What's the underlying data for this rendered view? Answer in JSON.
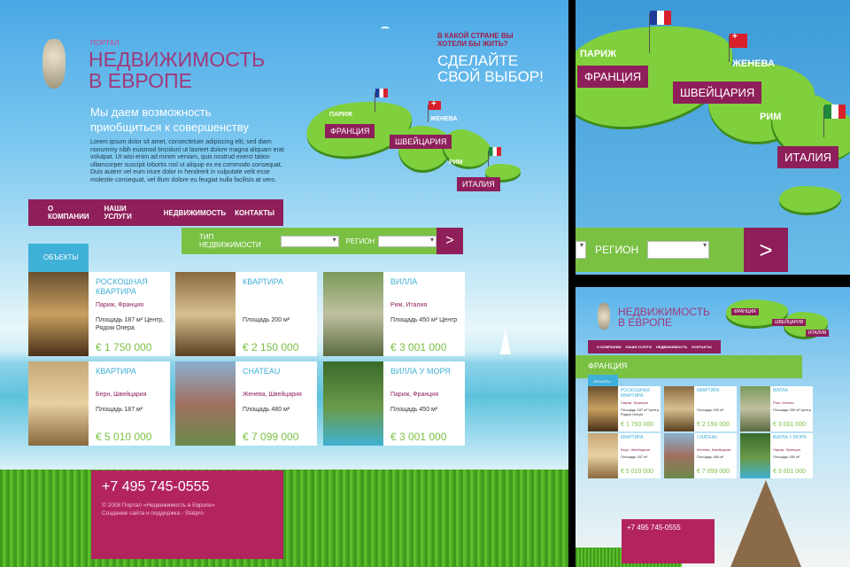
{
  "header": {
    "portal_label": "ПОРТАЛ",
    "title_line1": "НЕДВИЖИМОСТЬ",
    "title_line2": "В ЕВРОПЕ",
    "tagline": "Мы даем возможность приобщиться к совершенству",
    "body": "Lorem ipsum dolor sit amet, consectetuer adipiscing elit, sed diam nonummy nibh euismod tincidunt ut laoreet dolore magna aliquam erat volutpat. Ut wisi enim ad minim veniam, quis nostrud exerci tation ullamcorper suscipit lobortis nisl ut aliquip ex ea commodo consequat. Duis autem vel eum iriure dolor in hendrerit in vulputate velit esse molestie consequat, vel illum dolore eu feugiat nulla facilisis at vero."
  },
  "promo": {
    "question": "В КАКОЙ СТРАНЕ ВЫ ХОТЕЛИ БЫ ЖИТЬ?",
    "cta": "СДЕЛАЙТЕ СВОЙ ВЫБОР!"
  },
  "map": {
    "cities": [
      "ПАРИЖ",
      "ЖЕНЕВА",
      "РИМ"
    ],
    "countries": [
      "ФРАНЦИЯ",
      "ШВЕЙЦАРИЯ",
      "ИТАЛИЯ"
    ]
  },
  "nav": [
    "О КОМПАНИИ",
    "НАШИ УСЛУГИ",
    "НЕДВИЖИМОСТЬ",
    "КОНТАКТЫ"
  ],
  "search": {
    "type_label": "ТИП НЕДВИЖИМОСТИ",
    "region_label": "РЕГИОН",
    "go": ">"
  },
  "objects_tab": "ОБЪЕКТЫ",
  "listings": [
    {
      "title": "РОСКОШНАЯ КВАРТИРА",
      "city": "Париж, Франция",
      "details": "Площадь 187 м² Центр, Рядом Опера",
      "price": "€ 1 750 000"
    },
    {
      "title": "КВАРТИРА",
      "city": "",
      "details": "Площадь 200 м²",
      "price": "€ 2 150 000"
    },
    {
      "title": "ВИЛЛА",
      "city": "Рим, Италия",
      "details": "Площадь 450 м² Центр",
      "price": "€ 3 001 000"
    },
    {
      "title": "КВАРТИРА",
      "city": "Берн, Швейцария",
      "details": "Площадь 187 м²",
      "price": "€ 5 010 000"
    },
    {
      "title": "CHATEAU",
      "city": "Женева, Швейцария",
      "details": "Площадь 480 м²",
      "price": "€ 7 099 000"
    },
    {
      "title": "ВИЛЛА У МОРЯ",
      "city": "Париж, Франция",
      "details": "Площадь 450 м²",
      "price": "€ 3 001 000"
    }
  ],
  "footer": {
    "phone": "+7 495 745-0555",
    "copyright": "© 2008 Портал «Недвижимость в Европе»",
    "credit": "Создание сайта и поддержка - Statpro"
  },
  "zoom": {
    "cities": [
      "ПАРИЖ",
      "ЖЕНЕВА",
      "РИМ"
    ],
    "countries": [
      "ФРАНЦИЯ",
      "ШВЕЙЦАРИЯ",
      "ИТАЛИЯ"
    ],
    "region_label": "РЕГИОН",
    "go": ">"
  },
  "mini": {
    "country": "ФРАНЦИЯ",
    "phone": "+7 495 745-0555"
  },
  "colors": {
    "accent": "#8e1f5a",
    "green": "#7ac143",
    "blue": "#3fb0d8"
  }
}
